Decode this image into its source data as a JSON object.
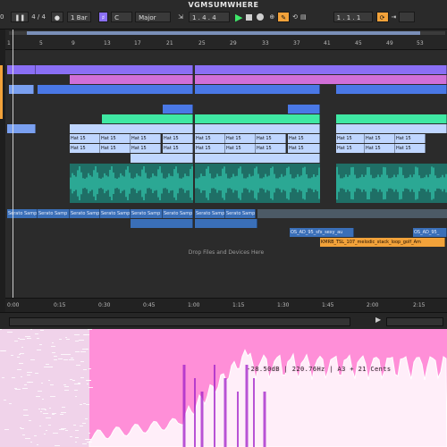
{
  "app": {
    "title": "VGMSUMWHERE"
  },
  "transport": {
    "tempo": "0",
    "time_sig": "4 / 4",
    "quantize": "1 Bar",
    "key": "C",
    "scale": "Major",
    "position": "1 . 4 . 4",
    "loop_pos": "1 . 1 . 1"
  },
  "ruler": {
    "bars": [
      "1",
      "5",
      "9",
      "13",
      "17",
      "21",
      "25",
      "29",
      "33",
      "37",
      "41",
      "45",
      "49",
      "53"
    ]
  },
  "timeline": {
    "times": [
      "0:00",
      "0:15",
      "0:30",
      "0:45",
      "1:00",
      "1:15",
      "1:30",
      "1:45",
      "2:00",
      "2:15"
    ]
  },
  "clips": {
    "hat_label": "Hat 15",
    "serato_label": "Serato Samp",
    "loop1": "OS_AD_95_sfx_sexy_au",
    "loop2": "OS_AD_95_",
    "loop3": "KMRB_TSL_107_melodic_stack_loop_golf_Am"
  },
  "drop_hint": "Drop Files and Devices Here",
  "spectrum": {
    "readout": "-28.50dB | 220.76Hz | A3 + 21 Cents"
  },
  "colors": {
    "violet": "#8a6ff5",
    "magenta": "#d06fd8",
    "blue": "#4a78e6",
    "green": "#3fe8a3",
    "teal": "#2fbfa5",
    "orange": "#f2a23a",
    "spectrum_bg": "#ff8fd8"
  }
}
